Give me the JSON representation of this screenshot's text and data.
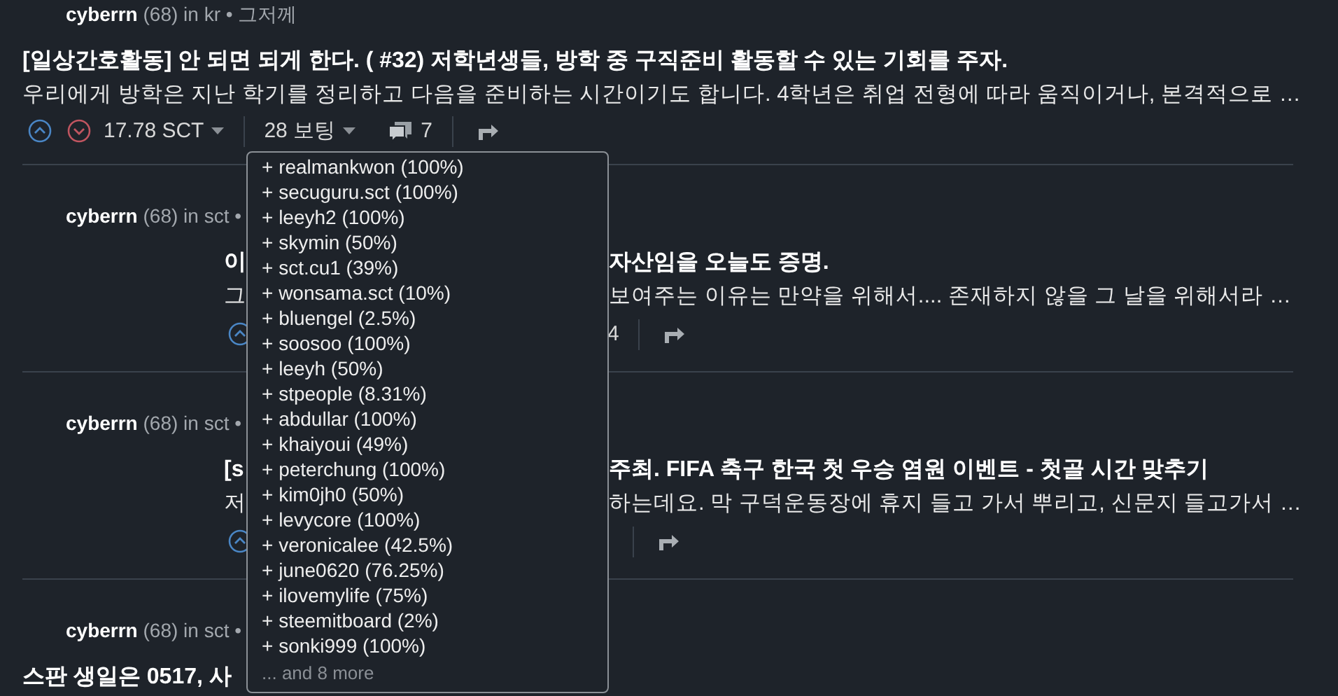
{
  "posts": [
    {
      "kind": "full",
      "author": "cyberrn",
      "meta": "(68) in kr • 그저께",
      "title": "[일상간호활동] 안 되면 되게 한다. ( #32) 저학년생들, 방학 중 구직준비 활동할 수 있는 기회를 주자.",
      "body": "우리에게 방학은 지난 학기를 정리하고 다음을 준비하는 시간이기도 합니다. 4학년은 취업 전형에 따라 움직이거나, 본격적으로 …",
      "payout": "17.78 SCT",
      "votes": "28 보팅",
      "comments": "7"
    },
    {
      "kind": "covered",
      "author": "cyberrn",
      "meta": "(68) in sct •",
      "title_left": "이",
      "title_right": "자산임을 오늘도 증명.",
      "body_left": "그",
      "body_right": "보여주는 이유는 만약을 위해서.... 존재하지 않을 그 날을 위해서라 …",
      "comments": "4"
    },
    {
      "kind": "covered",
      "author": "cyberrn",
      "meta": "(68) in sct •",
      "title_left": "[s",
      "title_right": "주최. FIFA 축구 한국 첫 우승 염원 이벤트 - 첫골 시간 맞추기",
      "body_left": "저",
      "body_right": "하는데요. 막 구덕운동장에 휴지 들고 가서 뿌리고, 신문지 들고가서 …"
    },
    {
      "kind": "title_only",
      "author": "cyberrn",
      "meta": "(68) in sct •",
      "title": "스판 생일은 0517, 사"
    }
  ],
  "voter_popup": {
    "voters": [
      "+ realmankwon (100%)",
      "+ secuguru.sct (100%)",
      "+ leeyh2 (100%)",
      "+ skymin (50%)",
      "+ sct.cu1 (39%)",
      "+ wonsama.sct (10%)",
      "+ bluengel (2.5%)",
      "+ soosoo (100%)",
      "+ leeyh (50%)",
      "+ stpeople (8.31%)",
      "+ abdullar (100%)",
      "+ khaiyoui (49%)",
      "+ peterchung (100%)",
      "+ kim0jh0 (50%)",
      "+ levycore (100%)",
      "+ veronicalee (42.5%)",
      "+ june0620 (76.25%)",
      "+ ilovemylife (75%)",
      "+ steemitboard (2%)",
      "+ sonki999 (100%)"
    ],
    "more": "... and 8 more"
  }
}
